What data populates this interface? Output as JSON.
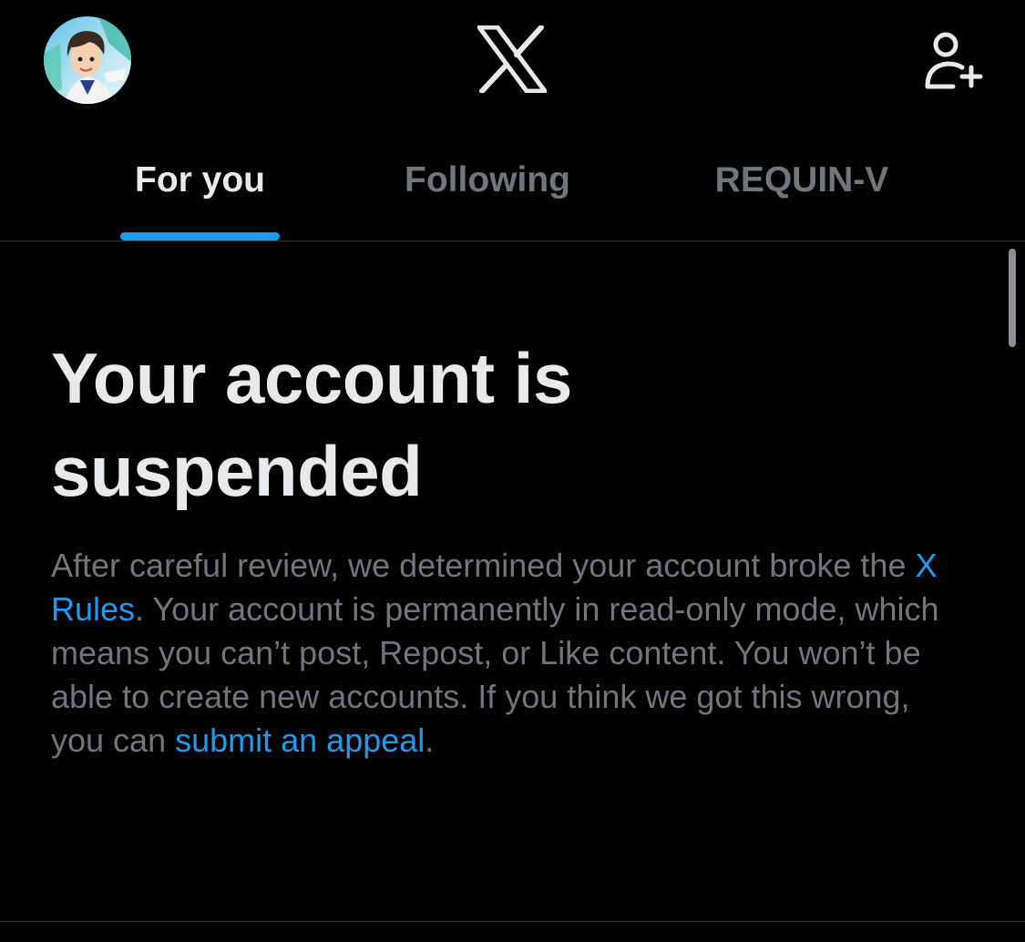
{
  "header": {
    "avatar_icon": "user-avatar",
    "logo_icon": "x-logo-icon",
    "add_account_icon": "add-user-icon"
  },
  "tabs": [
    {
      "label": "For you",
      "active": true
    },
    {
      "label": "Following",
      "active": false
    },
    {
      "label": "REQUIN-V",
      "active": false
    }
  ],
  "notice": {
    "title": "Your account is suspended",
    "text_1": "After careful review, we determined your account broke the ",
    "rules_link": "X Rules",
    "text_2": ". Your account is permanently in read-only mode, which means you can’t post, Repost, or Like content. You won’t be able to create new accounts. If you think we got this wrong, you can ",
    "appeal_link": "submit an appeal",
    "text_3": "."
  },
  "colors": {
    "background": "#000000",
    "accent": "#1d9bf0",
    "primary_text": "#e7e9ea",
    "secondary_text": "#71767b",
    "divider": "#2f3336"
  }
}
